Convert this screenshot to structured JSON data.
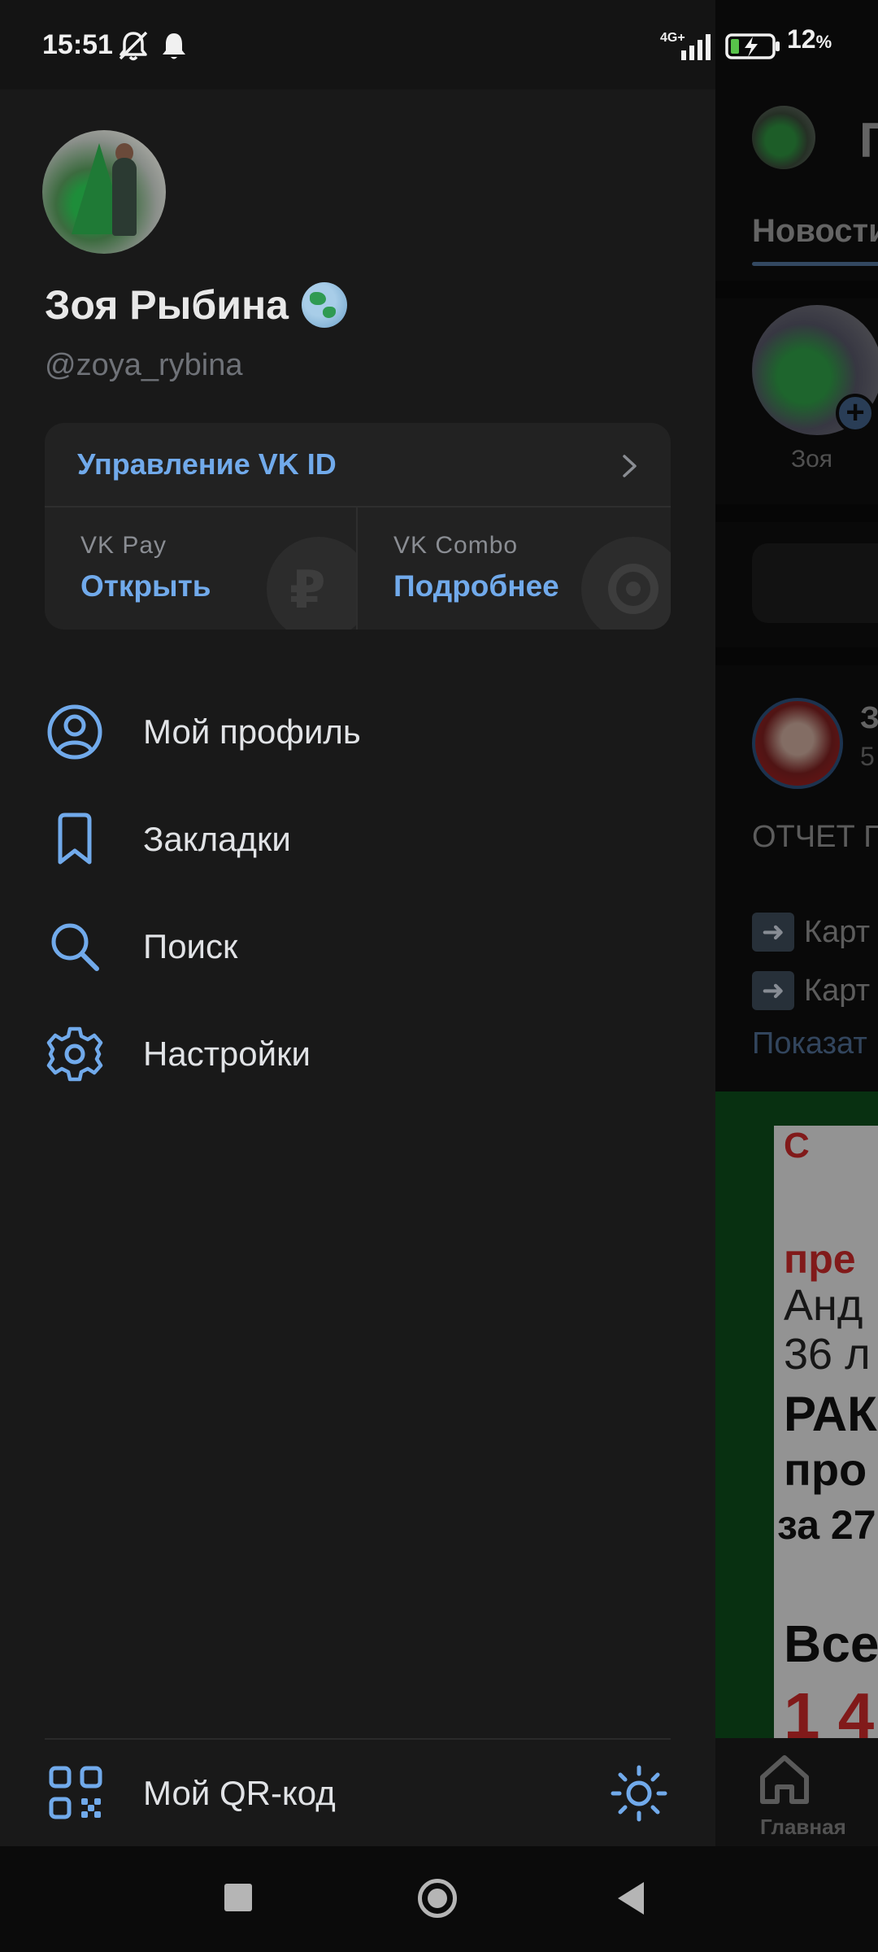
{
  "status_bar": {
    "time": "15:51",
    "network": "4G+",
    "battery": "12",
    "battery_unit": "%"
  },
  "profile": {
    "name": "Зоя Рыбина",
    "handle": "@zoya_rybina"
  },
  "vkid": {
    "manage_label": "Управление VK ID",
    "pay": {
      "caption": "VK Pay",
      "action": "Открыть",
      "icon": "ruble-icon",
      "glyph": "₽"
    },
    "combo": {
      "caption": "VK Combo",
      "action": "Подробнее",
      "icon": "combo-icon",
      "glyph": "C"
    }
  },
  "menu": [
    {
      "label": "Мой профиль",
      "icon": "user-circle-icon"
    },
    {
      "label": "Закладки",
      "icon": "bookmark-icon"
    },
    {
      "label": "Поиск",
      "icon": "search-icon"
    },
    {
      "label": "Настройки",
      "icon": "gear-icon"
    }
  ],
  "footer": {
    "qr_label": "Мой QR-код",
    "theme_icon": "sun-icon"
  },
  "feed": {
    "title": "Г",
    "tab": "Новости",
    "story_name": "Зоя",
    "post_author": "З",
    "post_sub": "5",
    "post_text": "ОТЧЕТ П",
    "post_line1": "Карт",
    "post_line2": "Карт",
    "show_more": "Показат",
    "poster": {
      "l1": "С",
      "l2": "пре",
      "l3": "Анд",
      "l4": "36 л",
      "l5": "РАК",
      "l6": "про",
      "l7": "за 27",
      "l8": "Все",
      "l9": "1 4"
    },
    "home_label": "Главная"
  },
  "colors": {
    "accent": "#71aaeb",
    "drawer_bg": "#191919",
    "card_bg": "#222222"
  }
}
